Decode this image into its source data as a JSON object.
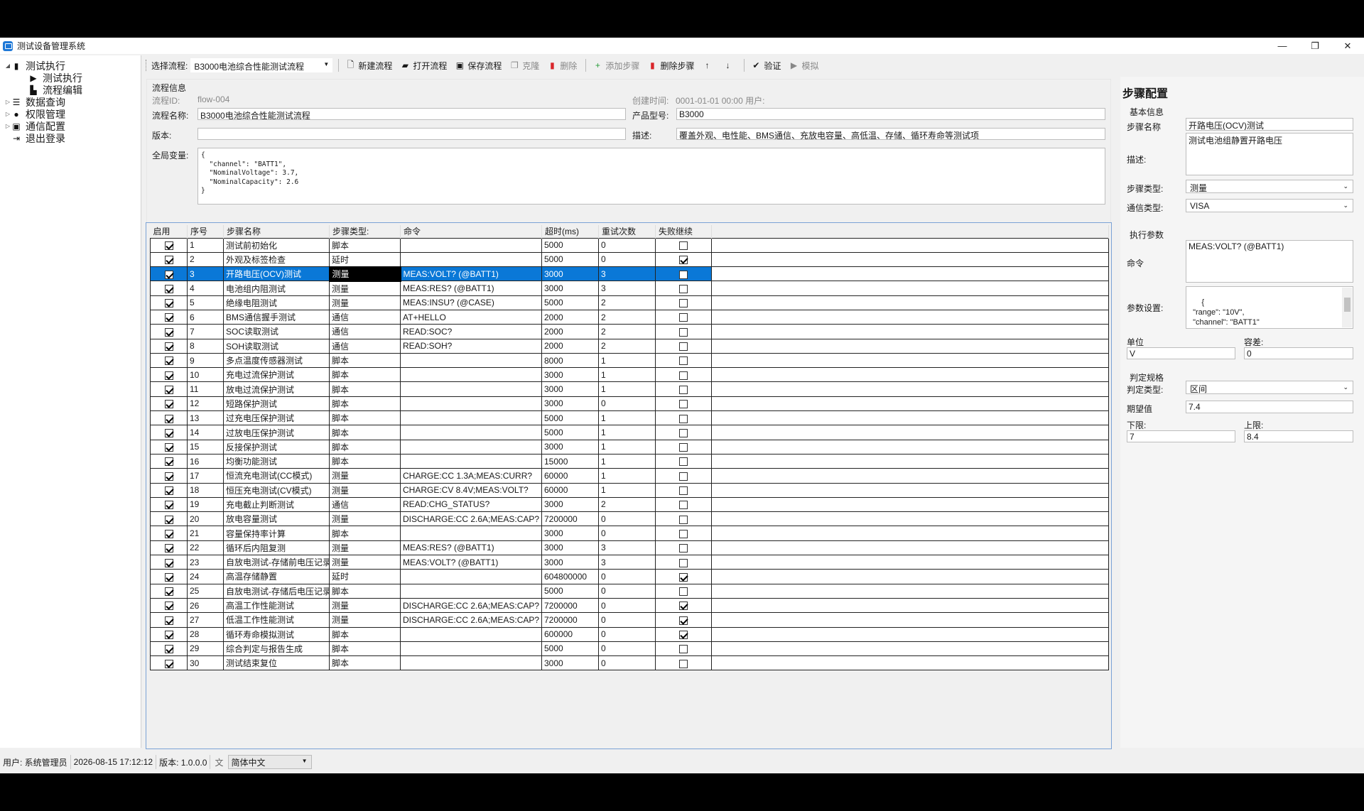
{
  "app": {
    "title": "测试设备管理系统"
  },
  "window_buttons": {
    "minimize": "—",
    "maximize": "❐",
    "close": "✕"
  },
  "tree": [
    {
      "label": "测试执行",
      "level": 0,
      "expanded": true,
      "icon": "device-icon"
    },
    {
      "label": "测试执行",
      "level": 1,
      "icon": "play-icon"
    },
    {
      "label": "流程编辑",
      "level": 1,
      "icon": "document-icon"
    },
    {
      "label": "数据查询",
      "level": 0,
      "icon": "database-icon"
    },
    {
      "label": "权限管理",
      "level": 0,
      "icon": "user-icon"
    },
    {
      "label": "通信配置",
      "level": 0,
      "icon": "network-icon"
    },
    {
      "label": "退出登录",
      "level": 0,
      "icon": "logout-icon"
    }
  ],
  "toolbar": {
    "select_label": "选择流程:",
    "select_value": "B3000电池综合性能测试流程",
    "new_flow": "新建流程",
    "open_flow": "打开流程",
    "save_flow": "保存流程",
    "clone": "克隆",
    "delete": "删除",
    "add_step": "添加步骤",
    "delete_step": "删除步骤",
    "verify": "验证",
    "simulate": "模拟"
  },
  "flow_info": {
    "header": "流程信息",
    "id_label": "流程ID:",
    "id_value": "flow-004",
    "created_label": "创建时间:",
    "created_value": "0001-01-01 00:00 用户:",
    "name_label": "流程名称:",
    "name_value": "B3000电池综合性能测试流程",
    "model_label": "产品型号:",
    "model_value": "B3000",
    "version_label": "版本:",
    "version_value": "",
    "desc_label": "描述:",
    "desc_value": "覆盖外观、电性能、BMS通信、充放电容量、高低温、存储、循环寿命等测试项",
    "globals_label": "全局变量:",
    "globals_value": "{\n  \"channel\": \"BATT1\",\n  \"NominalVoltage\": 3.7,\n  \"NominalCapacity\": 2.6\n}"
  },
  "grid": {
    "columns": [
      "启用",
      "序号",
      "步骤名称",
      "步骤类型:",
      "命令",
      "超时(ms)",
      "重试次数",
      "失败继续"
    ],
    "selected_index": 2,
    "rows": [
      {
        "enabled": true,
        "no": "1",
        "name": "测试前初始化",
        "type": "脚本",
        "cmd": "",
        "timeout": "5000",
        "retry": "0",
        "cont": false
      },
      {
        "enabled": true,
        "no": "2",
        "name": "外观及标签检查",
        "type": "延时",
        "cmd": "",
        "timeout": "5000",
        "retry": "0",
        "cont": true
      },
      {
        "enabled": true,
        "no": "3",
        "name": "开路电压(OCV)测试",
        "type": "测量",
        "cmd": "MEAS:VOLT? (@BATT1)",
        "timeout": "3000",
        "retry": "3",
        "cont": false
      },
      {
        "enabled": true,
        "no": "4",
        "name": "电池组内阻测试",
        "type": "测量",
        "cmd": "MEAS:RES? (@BATT1)",
        "timeout": "3000",
        "retry": "3",
        "cont": false
      },
      {
        "enabled": true,
        "no": "5",
        "name": "绝缘电阻测试",
        "type": "测量",
        "cmd": "MEAS:INSU? (@CASE)",
        "timeout": "5000",
        "retry": "2",
        "cont": false
      },
      {
        "enabled": true,
        "no": "6",
        "name": "BMS通信握手测试",
        "type": "通信",
        "cmd": "AT+HELLO",
        "timeout": "2000",
        "retry": "2",
        "cont": false
      },
      {
        "enabled": true,
        "no": "7",
        "name": "SOC读取测试",
        "type": "通信",
        "cmd": "READ:SOC?",
        "timeout": "2000",
        "retry": "2",
        "cont": false
      },
      {
        "enabled": true,
        "no": "8",
        "name": "SOH读取测试",
        "type": "通信",
        "cmd": "READ:SOH?",
        "timeout": "2000",
        "retry": "2",
        "cont": false
      },
      {
        "enabled": true,
        "no": "9",
        "name": "多点温度传感器测试",
        "type": "脚本",
        "cmd": "",
        "timeout": "8000",
        "retry": "1",
        "cont": false
      },
      {
        "enabled": true,
        "no": "10",
        "name": "充电过流保护测试",
        "type": "脚本",
        "cmd": "",
        "timeout": "3000",
        "retry": "1",
        "cont": false
      },
      {
        "enabled": true,
        "no": "11",
        "name": "放电过流保护测试",
        "type": "脚本",
        "cmd": "",
        "timeout": "3000",
        "retry": "1",
        "cont": false
      },
      {
        "enabled": true,
        "no": "12",
        "name": "短路保护测试",
        "type": "脚本",
        "cmd": "",
        "timeout": "3000",
        "retry": "0",
        "cont": false
      },
      {
        "enabled": true,
        "no": "13",
        "name": "过充电压保护测试",
        "type": "脚本",
        "cmd": "",
        "timeout": "5000",
        "retry": "1",
        "cont": false
      },
      {
        "enabled": true,
        "no": "14",
        "name": "过放电压保护测试",
        "type": "脚本",
        "cmd": "",
        "timeout": "5000",
        "retry": "1",
        "cont": false
      },
      {
        "enabled": true,
        "no": "15",
        "name": "反接保护测试",
        "type": "脚本",
        "cmd": "",
        "timeout": "3000",
        "retry": "1",
        "cont": false
      },
      {
        "enabled": true,
        "no": "16",
        "name": "均衡功能测试",
        "type": "脚本",
        "cmd": "",
        "timeout": "15000",
        "retry": "1",
        "cont": false
      },
      {
        "enabled": true,
        "no": "17",
        "name": "恒流充电测试(CC模式)",
        "type": "测量",
        "cmd": "CHARGE:CC 1.3A;MEAS:CURR?",
        "timeout": "60000",
        "retry": "1",
        "cont": false
      },
      {
        "enabled": true,
        "no": "18",
        "name": "恒压充电测试(CV模式)",
        "type": "测量",
        "cmd": "CHARGE:CV 8.4V;MEAS:VOLT?",
        "timeout": "60000",
        "retry": "1",
        "cont": false
      },
      {
        "enabled": true,
        "no": "19",
        "name": "充电截止判断测试",
        "type": "通信",
        "cmd": "READ:CHG_STATUS?",
        "timeout": "3000",
        "retry": "2",
        "cont": false
      },
      {
        "enabled": true,
        "no": "20",
        "name": "放电容量测试",
        "type": "测量",
        "cmd": "DISCHARGE:CC 2.6A;MEAS:CAP?",
        "timeout": "7200000",
        "retry": "0",
        "cont": false
      },
      {
        "enabled": true,
        "no": "21",
        "name": "容量保持率计算",
        "type": "脚本",
        "cmd": "",
        "timeout": "3000",
        "retry": "0",
        "cont": false
      },
      {
        "enabled": true,
        "no": "22",
        "name": "循环后内阻复测",
        "type": "测量",
        "cmd": "MEAS:RES? (@BATT1)",
        "timeout": "3000",
        "retry": "3",
        "cont": false
      },
      {
        "enabled": true,
        "no": "23",
        "name": "自放电测试-存储前电压记录",
        "type": "测量",
        "cmd": "MEAS:VOLT? (@BATT1)",
        "timeout": "3000",
        "retry": "3",
        "cont": false
      },
      {
        "enabled": true,
        "no": "24",
        "name": "高温存储静置",
        "type": "延时",
        "cmd": "",
        "timeout": "604800000",
        "retry": "0",
        "cont": true
      },
      {
        "enabled": true,
        "no": "25",
        "name": "自放电测试-存储后电压记录",
        "type": "脚本",
        "cmd": "",
        "timeout": "5000",
        "retry": "0",
        "cont": false
      },
      {
        "enabled": true,
        "no": "26",
        "name": "高温工作性能测试",
        "type": "测量",
        "cmd": "DISCHARGE:CC 2.6A;MEAS:CAP?",
        "timeout": "7200000",
        "retry": "0",
        "cont": true
      },
      {
        "enabled": true,
        "no": "27",
        "name": "低温工作性能测试",
        "type": "测量",
        "cmd": "DISCHARGE:CC 2.6A;MEAS:CAP?",
        "timeout": "7200000",
        "retry": "0",
        "cont": true
      },
      {
        "enabled": true,
        "no": "28",
        "name": "循环寿命模拟测试",
        "type": "脚本",
        "cmd": "",
        "timeout": "600000",
        "retry": "0",
        "cont": true
      },
      {
        "enabled": true,
        "no": "29",
        "name": "综合判定与报告生成",
        "type": "脚本",
        "cmd": "",
        "timeout": "5000",
        "retry": "0",
        "cont": false
      },
      {
        "enabled": true,
        "no": "30",
        "name": "测试结束复位",
        "type": "脚本",
        "cmd": "",
        "timeout": "3000",
        "retry": "0",
        "cont": false
      }
    ]
  },
  "step_config": {
    "title": "步骤配置",
    "basic_header": "基本信息",
    "name_label": "步骤名称",
    "name_value": "开路电压(OCV)测试",
    "desc_label": "描述:",
    "desc_value": "测试电池组静置开路电压",
    "type_label": "步骤类型:",
    "type_value": "测量",
    "comm_label": "通信类型:",
    "comm_value": "VISA",
    "exec_header": "执行参数",
    "cmd_label": "命令",
    "cmd_value": "MEAS:VOLT? (@BATT1)",
    "params_label": "参数设置:",
    "params_value": "{\n  \"range\": \"10V\",\n  \"channel\": \"BATT1\"\n}",
    "unit_label": "单位",
    "unit_value": "V",
    "tol_label": "容差:",
    "tol_value": "0",
    "judge_header": "判定规格",
    "judge_type_label": "判定类型:",
    "judge_type_value": "区间",
    "expect_label": "期望值",
    "expect_value": "7.4",
    "lower_label": "下限:",
    "lower_value": "7",
    "upper_label": "上限:",
    "upper_value": "8.4"
  },
  "status": {
    "user": "用户: 系统管理员",
    "time": "2026-08-15 17:12:12",
    "version": "版本: 1.0.0.0",
    "language": "简体中文"
  },
  "colors": {
    "accent": "#0a78d7",
    "delete_red": "#d9262b",
    "add_green": "#2a9d3a"
  }
}
